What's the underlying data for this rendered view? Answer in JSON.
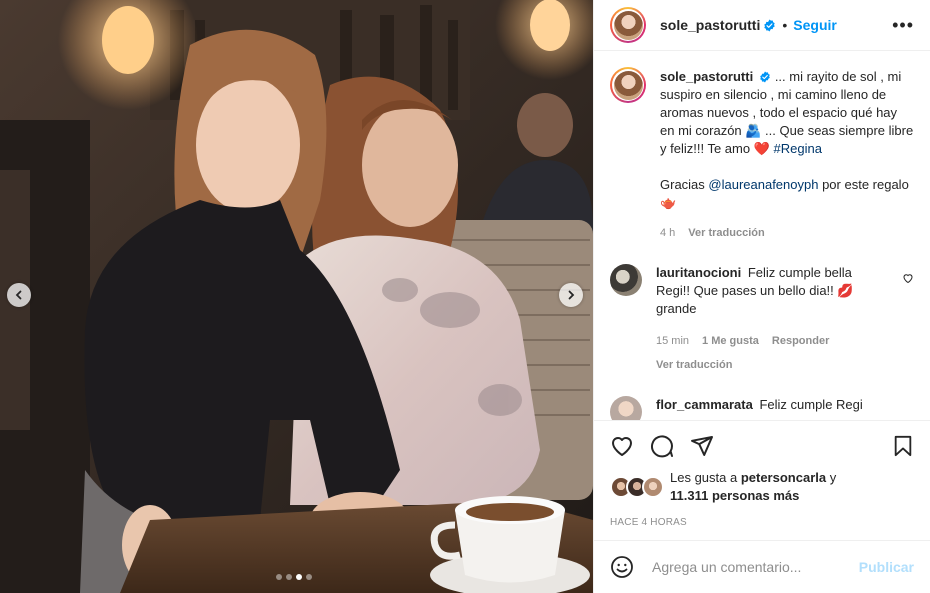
{
  "post": {
    "username": "sole_pastorutti",
    "follow_label": "Seguir",
    "bullet": "•",
    "more_label": "•••"
  },
  "caption": {
    "username": "sole_pastorutti",
    "text_1": "... mi rayito de sol , mi suspiro en silencio , mi camino lleno de aromas nuevos , todo el espacio qué hay en mi corazón 🫂 ... Que seas siempre libre y feliz!!! Te amo ",
    "heart": "❤️",
    "hashtag": "#Regina",
    "thanks_prefix": "Gracias ",
    "mention": "@laureanafenoyph",
    "thanks_suffix": " por este regalo 🫖",
    "time": "4 h",
    "translate": "Ver traducción"
  },
  "comments": [
    {
      "username": "lauritanocioni",
      "text": "Feliz cumple bella Regi!! Que pases un bello dia!! 💋 grande",
      "time": "15 min",
      "likes": "1 Me gusta",
      "reply": "Responder",
      "translate": "Ver traducción"
    },
    {
      "username": "flor_cammarata",
      "text": "Feliz cumple Regi"
    }
  ],
  "likes": {
    "prefix": "Les gusta a ",
    "user": "petersoncarla",
    "and": " y",
    "count": "11.311 personas más"
  },
  "timeago": "HACE 4 HORAS",
  "composer": {
    "placeholder": "Agrega un comentario...",
    "publish": "Publicar"
  },
  "carousel": {
    "total": 4,
    "active": 3
  },
  "colors": {
    "accent": "#0095f6",
    "link": "#00376b",
    "muted": "#8e8e8e",
    "publish_disabled": "#b2dffc"
  },
  "icons": [
    "verified-badge-icon",
    "more-icon",
    "heart-icon",
    "comment-icon",
    "share-icon",
    "bookmark-icon",
    "emoji-icon",
    "chevron-left-icon",
    "chevron-right-icon"
  ]
}
